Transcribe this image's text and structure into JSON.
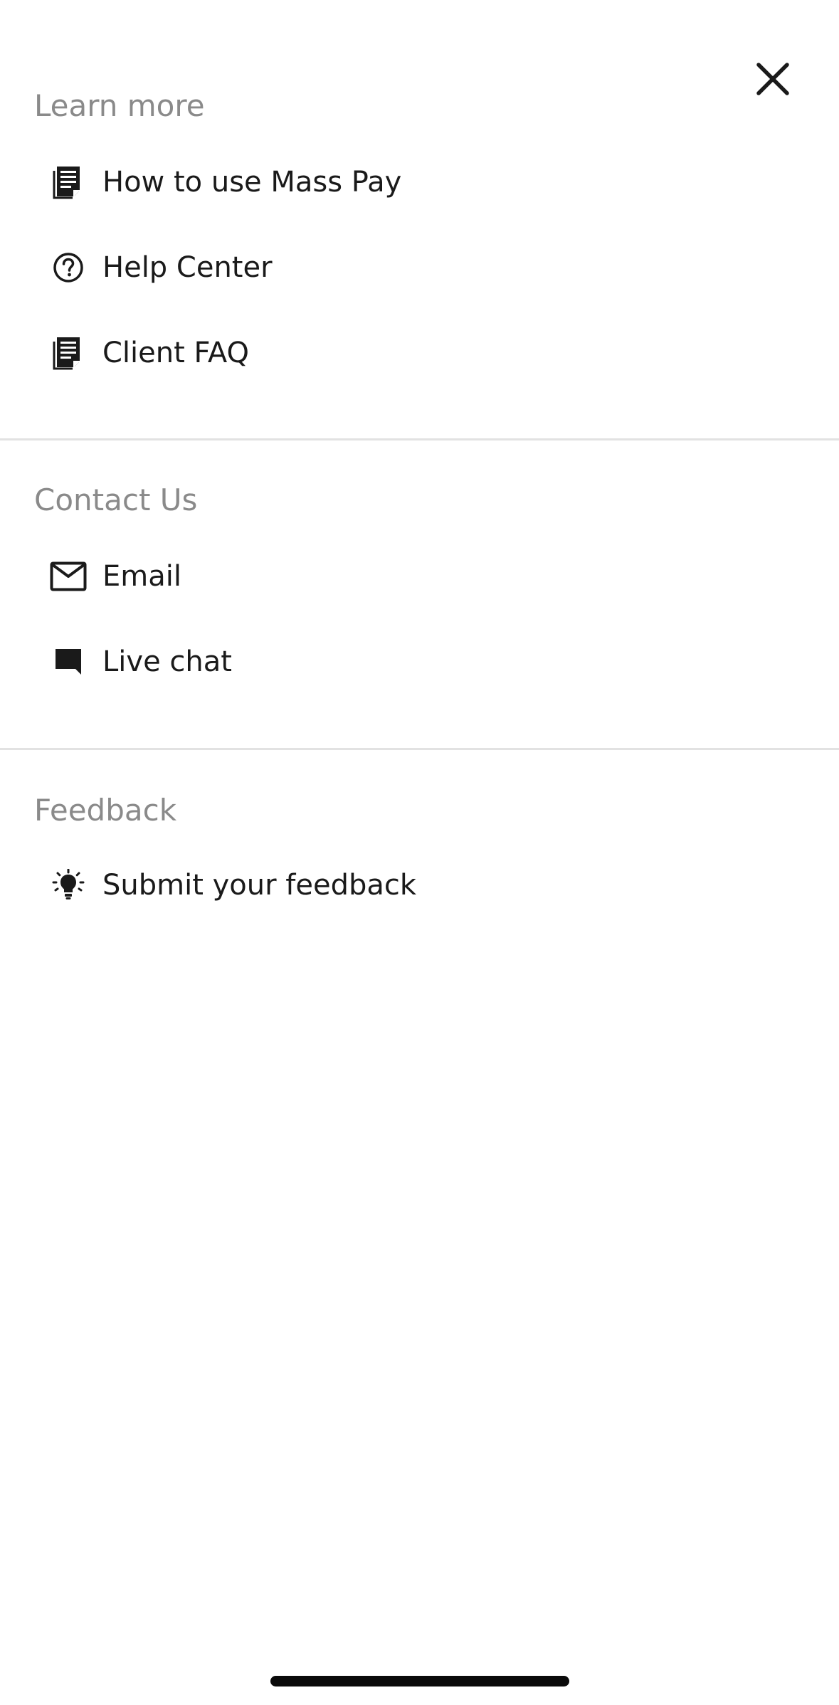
{
  "sections": [
    {
      "title": "Learn more",
      "items": [
        {
          "label": "How to use Mass Pay",
          "icon": "document-icon"
        },
        {
          "label": "Help Center",
          "icon": "help-circle-icon"
        },
        {
          "label": "Client FAQ",
          "icon": "document-icon"
        }
      ]
    },
    {
      "title": "Contact Us",
      "items": [
        {
          "label": "Email",
          "icon": "mail-icon"
        },
        {
          "label": "Live chat",
          "icon": "chat-bubble-icon"
        }
      ]
    },
    {
      "title": "Feedback",
      "items": [
        {
          "label": "Submit your feedback",
          "icon": "lightbulb-icon"
        }
      ]
    }
  ],
  "colors": {
    "section_title": "#8a8a8a",
    "text": "#1a1a1a",
    "divider": "#e2e2e2",
    "background": "#ffffff"
  }
}
